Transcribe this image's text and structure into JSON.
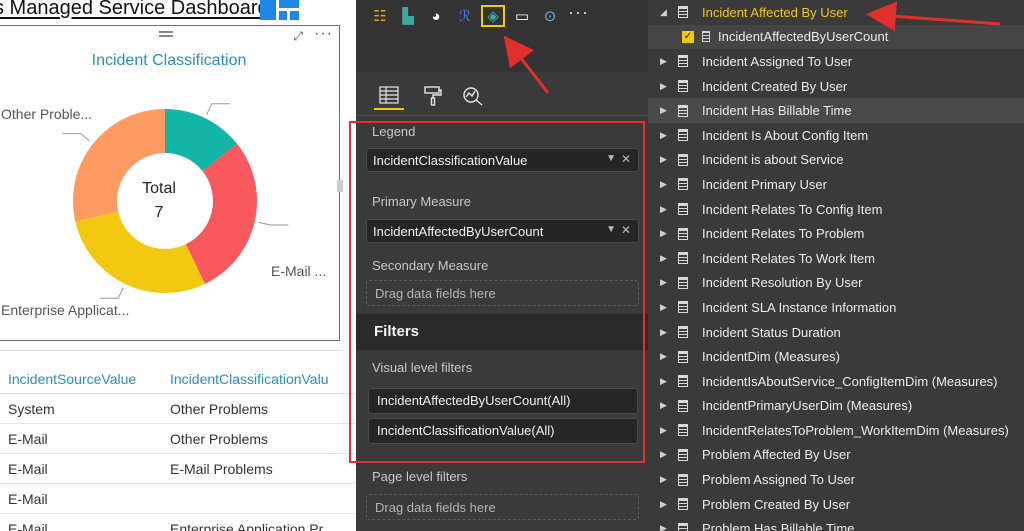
{
  "report": {
    "title": "s Managed Service Dashboard"
  },
  "visual": {
    "title": "Incident Classification",
    "center_label": "Total",
    "center_value": "7",
    "focus_icon": "focus-mode-icon",
    "more_label": "···"
  },
  "chart_data": {
    "type": "pie",
    "title": "Incident Classification",
    "donut": true,
    "total": 7,
    "slices": [
      {
        "label": "",
        "value": 1,
        "color": "#13b5a6"
      },
      {
        "label": "E-Mail ...",
        "value": 2,
        "color": "#f7595e"
      },
      {
        "label": "Enterprise Applicat...",
        "value": 2,
        "color": "#f2c811"
      },
      {
        "label": "Other Proble...",
        "value": 2,
        "color": "#fd9b63"
      }
    ]
  },
  "table": {
    "headers": [
      "IncidentSourceValue",
      "IncidentClassificationValu"
    ],
    "rows": [
      [
        "System",
        "Other Problems"
      ],
      [
        "E-Mail",
        "Other Problems"
      ],
      [
        "E-Mail",
        "E-Mail Problems"
      ],
      [
        "E-Mail",
        ""
      ],
      [
        "E-Mail",
        "Enterprise Application Pr"
      ]
    ]
  },
  "viz_pane": {
    "icons": [
      {
        "name": "table-visual-icon",
        "glyph": "☷",
        "color": "#e8a33a"
      },
      {
        "name": "waterfall-visual-icon",
        "glyph": "▙",
        "color": "#3fa7a0"
      },
      {
        "name": "globe-visual-icon",
        "glyph": "◕",
        "color": "#ffffff"
      },
      {
        "name": "r-script-visual-icon",
        "glyph": "ℛ",
        "color": "#3b7dd8"
      },
      {
        "name": "custom-visual-icon",
        "glyph": "◈",
        "color": "#f2c811"
      },
      {
        "name": "card-visual-icon",
        "glyph": "▭",
        "color": "#ffffff"
      },
      {
        "name": "gauge-visual-icon",
        "glyph": "⊙",
        "color": "#6fb4e8"
      }
    ],
    "more_label": "···",
    "tabs": [
      {
        "name": "fields-tab-icon",
        "glyph": "☰"
      },
      {
        "name": "format-paint-tab-icon",
        "glyph": "🖌"
      },
      {
        "name": "analytics-tab-icon",
        "glyph": "⌕"
      }
    ],
    "legend_label": "Legend",
    "legend_value": "IncidentClassificationValue",
    "primary_label": "Primary Measure",
    "primary_value": "IncidentAffectedByUserCount",
    "secondary_label": "Secondary Measure",
    "drop_placeholder": "Drag data fields here",
    "filters_header": "Filters",
    "visual_filters_label": "Visual level filters",
    "visual_filters": [
      "IncidentAffectedByUserCount(All)",
      "IncidentClassificationValue(All)"
    ],
    "page_filters_label": "Page level filters",
    "page_drop_placeholder": "Drag data fields here"
  },
  "fields_pane": {
    "items": [
      {
        "label": "Incident Affected By User",
        "expanded": true,
        "selected": true
      },
      {
        "label": "IncidentAffectedByUserCount",
        "sub": true,
        "checked": true
      },
      {
        "label": "Incident Assigned To User"
      },
      {
        "label": "Incident Created By User"
      },
      {
        "label": "Incident Has Billable Time",
        "highlight": true
      },
      {
        "label": "Incident Is About Config Item"
      },
      {
        "label": "Incident is about Service"
      },
      {
        "label": "Incident Primary User"
      },
      {
        "label": "Incident Relates To Config Item"
      },
      {
        "label": "Incident Relates To Problem"
      },
      {
        "label": "Incident Relates To Work Item"
      },
      {
        "label": "Incident Resolution By User"
      },
      {
        "label": "Incident SLA Instance Information"
      },
      {
        "label": "Incident Status Duration"
      },
      {
        "label": "IncidentDim (Measures)"
      },
      {
        "label": "IncidentIsAboutService_ConfigItemDim (Measures)"
      },
      {
        "label": "IncidentPrimaryUserDim (Measures)"
      },
      {
        "label": "IncidentRelatesToProblem_WorkItemDim (Measures)"
      },
      {
        "label": "Problem Affected By User"
      },
      {
        "label": "Problem Assigned To User"
      },
      {
        "label": "Problem Created By User"
      },
      {
        "label": "Problem Has Billable Time"
      }
    ]
  },
  "colors": {
    "annotation": "#e0302b",
    "accent": "#f2c811",
    "pane_bg": "#3a3a3a",
    "title_blue": "#2b8fb8"
  }
}
